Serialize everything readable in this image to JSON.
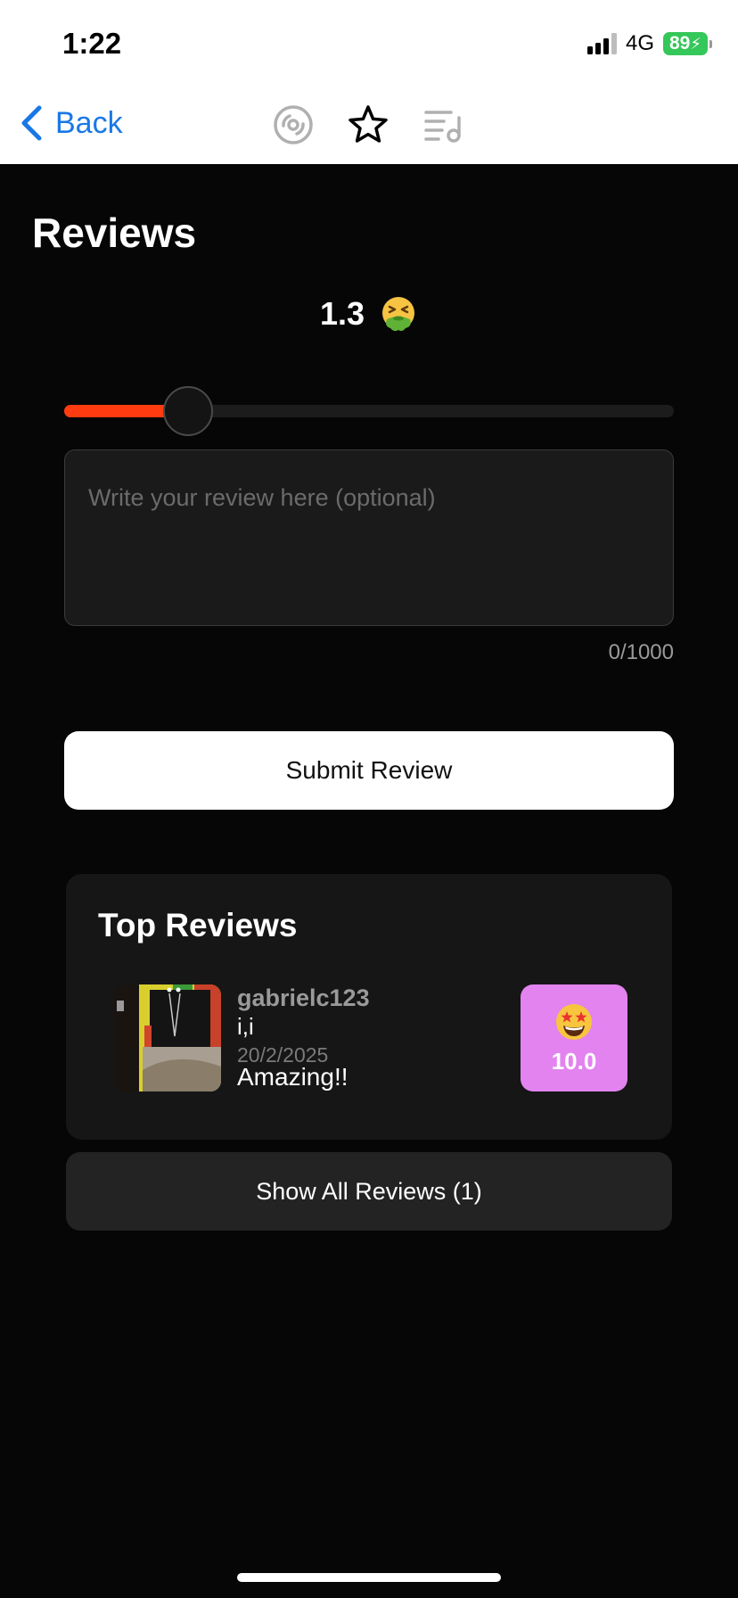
{
  "status_bar": {
    "time": "1:22",
    "network": "4G",
    "battery": "89"
  },
  "nav": {
    "back_label": "Back",
    "icons": [
      "disc-icon",
      "star-icon",
      "music-queue-icon"
    ],
    "accent_color": "#1a78e6"
  },
  "page": {
    "title": "Reviews"
  },
  "rating": {
    "value": "1.3",
    "emoji": "nauseated-face",
    "slider_value": 1.3,
    "slider_max": 10,
    "slider_fill_color": "#ff3b0f"
  },
  "review_form": {
    "placeholder": "Write your review here (optional)",
    "value": "",
    "char_count": "0/1000",
    "submit_label": "Submit Review"
  },
  "top_reviews": {
    "title": "Top Reviews",
    "items": [
      {
        "username": "gabrielc123",
        "album": "i,i",
        "date": "20/2/2025",
        "text": "Amazing!!",
        "score": "10.0",
        "score_emoji": "star-struck",
        "badge_color": "#e283ef"
      }
    ]
  },
  "show_all_label": "Show All Reviews (1)"
}
